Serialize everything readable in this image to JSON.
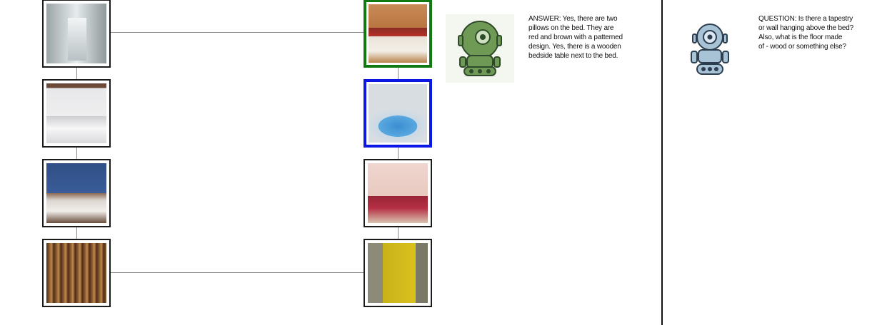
{
  "left_column": {
    "images": [
      {
        "name": "hallway-photo",
        "depicts": "hospital-hallway"
      },
      {
        "name": "bedroom-two-beds-photo",
        "depicts": "white-room-two-beds"
      },
      {
        "name": "blue-bedroom-photo",
        "depicts": "blue-walled-bedroom"
      },
      {
        "name": "archive-shelves-photo",
        "depicts": "archive-aisle"
      }
    ]
  },
  "right_column": {
    "images": [
      {
        "name": "bedroom-red-pillows-photo",
        "depicts": "bed-with-red-pillows",
        "selected": "green"
      },
      {
        "name": "indoor-pool-photo",
        "depicts": "indoor-hot-tub",
        "selected": "blue"
      },
      {
        "name": "pink-bedroom-photo",
        "depicts": "bedroom-pink-walls"
      },
      {
        "name": "yellow-door-photo",
        "depicts": "yellow-door"
      }
    ]
  },
  "colors": {
    "selected_green": "#0f7a12",
    "selected_blue": "#0a18e6",
    "answer_bot": "#6f9a55",
    "question_bot": "#a9c3d6"
  },
  "dialog": {
    "answer": {
      "icon": "green-robot-icon",
      "text": "ANSWER: Yes, there are two\npillows on the bed. They are\nred and brown with a patterned\ndesign. Yes, there is a wooden\nbedside table next to the bed."
    },
    "question": {
      "icon": "blue-robot-icon",
      "text": "QUESTION: Is there a tapestry\nor wall hanging above the bed?\nAlso, what is the floor made\nof - wood or something else?"
    }
  }
}
